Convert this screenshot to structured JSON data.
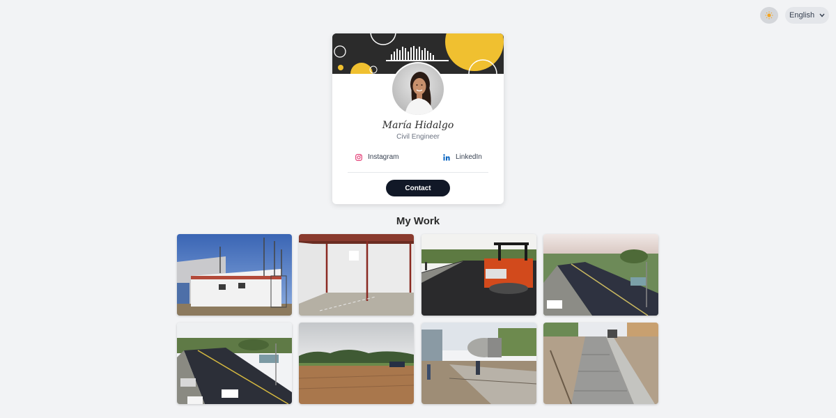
{
  "header": {
    "theme_icon": "sun-icon",
    "language": {
      "selected": "English",
      "chevron_icon": "chevron-down-icon"
    }
  },
  "profile": {
    "name": "María Hidalgo",
    "title": "Civil Engineer",
    "avatar_icon": "avatar-photo",
    "social": [
      {
        "label": "Instagram",
        "icon": "instagram-icon",
        "color": "#e1306c"
      },
      {
        "label": "LinkedIn",
        "icon": "linkedin-icon",
        "color": "#0a66c2"
      }
    ],
    "contact_label": "Contact",
    "banner_colors": {
      "dark": "#2b2b2b",
      "accent": "#f0c030"
    }
  },
  "work": {
    "title": "My Work",
    "photos": [
      {
        "subject": "building-under-construction"
      },
      {
        "subject": "warehouse-interior"
      },
      {
        "subject": "road-paving-roller"
      },
      {
        "subject": "highway-aerial"
      },
      {
        "subject": "highway-street"
      },
      {
        "subject": "dirt-field"
      },
      {
        "subject": "concrete-mixer-curb"
      },
      {
        "subject": "concrete-sidewalk"
      }
    ]
  }
}
